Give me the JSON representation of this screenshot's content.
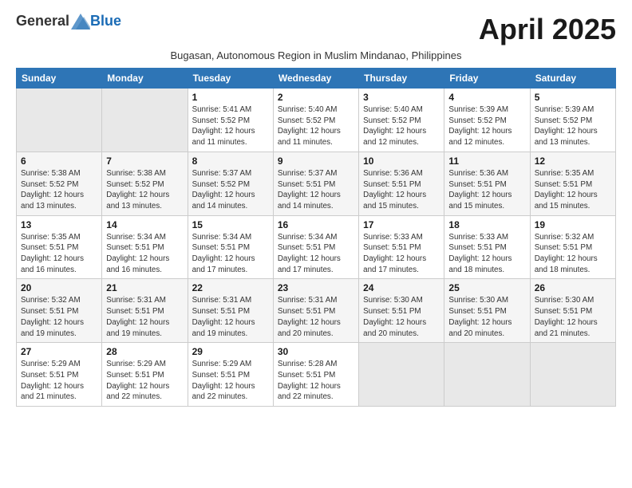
{
  "header": {
    "logo_general": "General",
    "logo_blue": "Blue",
    "month_title": "April 2025",
    "subtitle": "Bugasan, Autonomous Region in Muslim Mindanao, Philippines"
  },
  "columns": [
    "Sunday",
    "Monday",
    "Tuesday",
    "Wednesday",
    "Thursday",
    "Friday",
    "Saturday"
  ],
  "weeks": [
    [
      {
        "day": "",
        "info": ""
      },
      {
        "day": "",
        "info": ""
      },
      {
        "day": "1",
        "info": "Sunrise: 5:41 AM\nSunset: 5:52 PM\nDaylight: 12 hours and 11 minutes."
      },
      {
        "day": "2",
        "info": "Sunrise: 5:40 AM\nSunset: 5:52 PM\nDaylight: 12 hours and 11 minutes."
      },
      {
        "day": "3",
        "info": "Sunrise: 5:40 AM\nSunset: 5:52 PM\nDaylight: 12 hours and 12 minutes."
      },
      {
        "day": "4",
        "info": "Sunrise: 5:39 AM\nSunset: 5:52 PM\nDaylight: 12 hours and 12 minutes."
      },
      {
        "day": "5",
        "info": "Sunrise: 5:39 AM\nSunset: 5:52 PM\nDaylight: 12 hours and 13 minutes."
      }
    ],
    [
      {
        "day": "6",
        "info": "Sunrise: 5:38 AM\nSunset: 5:52 PM\nDaylight: 12 hours and 13 minutes."
      },
      {
        "day": "7",
        "info": "Sunrise: 5:38 AM\nSunset: 5:52 PM\nDaylight: 12 hours and 13 minutes."
      },
      {
        "day": "8",
        "info": "Sunrise: 5:37 AM\nSunset: 5:52 PM\nDaylight: 12 hours and 14 minutes."
      },
      {
        "day": "9",
        "info": "Sunrise: 5:37 AM\nSunset: 5:51 PM\nDaylight: 12 hours and 14 minutes."
      },
      {
        "day": "10",
        "info": "Sunrise: 5:36 AM\nSunset: 5:51 PM\nDaylight: 12 hours and 15 minutes."
      },
      {
        "day": "11",
        "info": "Sunrise: 5:36 AM\nSunset: 5:51 PM\nDaylight: 12 hours and 15 minutes."
      },
      {
        "day": "12",
        "info": "Sunrise: 5:35 AM\nSunset: 5:51 PM\nDaylight: 12 hours and 15 minutes."
      }
    ],
    [
      {
        "day": "13",
        "info": "Sunrise: 5:35 AM\nSunset: 5:51 PM\nDaylight: 12 hours and 16 minutes."
      },
      {
        "day": "14",
        "info": "Sunrise: 5:34 AM\nSunset: 5:51 PM\nDaylight: 12 hours and 16 minutes."
      },
      {
        "day": "15",
        "info": "Sunrise: 5:34 AM\nSunset: 5:51 PM\nDaylight: 12 hours and 17 minutes."
      },
      {
        "day": "16",
        "info": "Sunrise: 5:34 AM\nSunset: 5:51 PM\nDaylight: 12 hours and 17 minutes."
      },
      {
        "day": "17",
        "info": "Sunrise: 5:33 AM\nSunset: 5:51 PM\nDaylight: 12 hours and 17 minutes."
      },
      {
        "day": "18",
        "info": "Sunrise: 5:33 AM\nSunset: 5:51 PM\nDaylight: 12 hours and 18 minutes."
      },
      {
        "day": "19",
        "info": "Sunrise: 5:32 AM\nSunset: 5:51 PM\nDaylight: 12 hours and 18 minutes."
      }
    ],
    [
      {
        "day": "20",
        "info": "Sunrise: 5:32 AM\nSunset: 5:51 PM\nDaylight: 12 hours and 19 minutes."
      },
      {
        "day": "21",
        "info": "Sunrise: 5:31 AM\nSunset: 5:51 PM\nDaylight: 12 hours and 19 minutes."
      },
      {
        "day": "22",
        "info": "Sunrise: 5:31 AM\nSunset: 5:51 PM\nDaylight: 12 hours and 19 minutes."
      },
      {
        "day": "23",
        "info": "Sunrise: 5:31 AM\nSunset: 5:51 PM\nDaylight: 12 hours and 20 minutes."
      },
      {
        "day": "24",
        "info": "Sunrise: 5:30 AM\nSunset: 5:51 PM\nDaylight: 12 hours and 20 minutes."
      },
      {
        "day": "25",
        "info": "Sunrise: 5:30 AM\nSunset: 5:51 PM\nDaylight: 12 hours and 20 minutes."
      },
      {
        "day": "26",
        "info": "Sunrise: 5:30 AM\nSunset: 5:51 PM\nDaylight: 12 hours and 21 minutes."
      }
    ],
    [
      {
        "day": "27",
        "info": "Sunrise: 5:29 AM\nSunset: 5:51 PM\nDaylight: 12 hours and 21 minutes."
      },
      {
        "day": "28",
        "info": "Sunrise: 5:29 AM\nSunset: 5:51 PM\nDaylight: 12 hours and 22 minutes."
      },
      {
        "day": "29",
        "info": "Sunrise: 5:29 AM\nSunset: 5:51 PM\nDaylight: 12 hours and 22 minutes."
      },
      {
        "day": "30",
        "info": "Sunrise: 5:28 AM\nSunset: 5:51 PM\nDaylight: 12 hours and 22 minutes."
      },
      {
        "day": "",
        "info": ""
      },
      {
        "day": "",
        "info": ""
      },
      {
        "day": "",
        "info": ""
      }
    ]
  ]
}
